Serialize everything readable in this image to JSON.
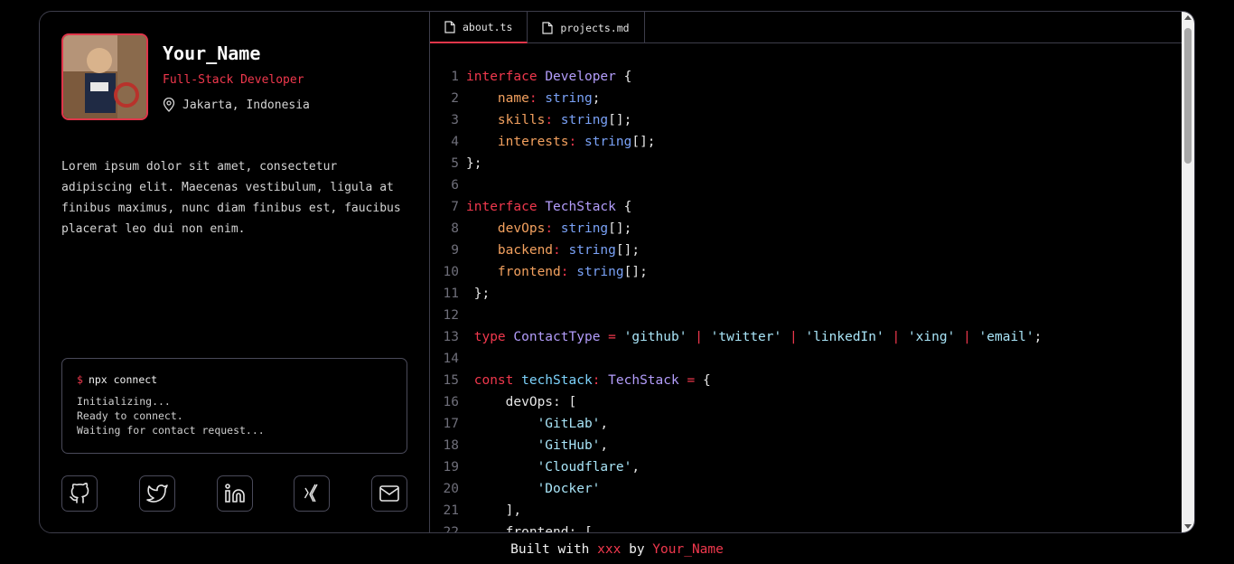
{
  "profile": {
    "name": "Your_Name",
    "role": "Full-Stack Developer",
    "location": "Jakarta, Indonesia",
    "bio": "Lorem ipsum dolor sit amet, consectetur adipiscing elit. Maecenas vestibulum, ligula at finibus maximus, nunc diam finibus est, faucibus placerat leo dui non enim."
  },
  "terminal": {
    "prompt": "$",
    "command": "npx connect",
    "lines": [
      "Initializing...",
      "Ready to connect.",
      "Waiting for contact request..."
    ]
  },
  "socials": [
    "github-icon",
    "twitter-icon",
    "linkedin-icon",
    "xing-icon",
    "email-icon"
  ],
  "tabs": [
    {
      "label": "about.ts",
      "active": true
    },
    {
      "label": "projects.md",
      "active": false
    }
  ],
  "code": [
    {
      "n": "1",
      "t": [
        [
          "k",
          "interface "
        ],
        [
          "t",
          "Developer"
        ],
        [
          "w",
          " {"
        ]
      ]
    },
    {
      "n": "2",
      "t": [
        [
          "w",
          "    "
        ],
        [
          "p",
          "name"
        ],
        [
          "k",
          ":"
        ],
        [
          "ty",
          " string"
        ],
        [
          "w",
          ";"
        ]
      ]
    },
    {
      "n": "3",
      "t": [
        [
          "w",
          "    "
        ],
        [
          "p",
          "skills"
        ],
        [
          "k",
          ":"
        ],
        [
          "ty",
          " string"
        ],
        [
          "w",
          "[];"
        ]
      ]
    },
    {
      "n": "4",
      "t": [
        [
          "w",
          "    "
        ],
        [
          "p",
          "interests"
        ],
        [
          "k",
          ":"
        ],
        [
          "ty",
          " string"
        ],
        [
          "w",
          "[];"
        ]
      ]
    },
    {
      "n": "5",
      "t": [
        [
          "w",
          "};"
        ]
      ]
    },
    {
      "n": "6",
      "t": []
    },
    {
      "n": "7",
      "t": [
        [
          "k",
          "interface "
        ],
        [
          "t",
          "TechStack"
        ],
        [
          "w",
          " {"
        ]
      ]
    },
    {
      "n": "8",
      "t": [
        [
          "w",
          "    "
        ],
        [
          "p",
          "devOps"
        ],
        [
          "k",
          ":"
        ],
        [
          "ty",
          " string"
        ],
        [
          "w",
          "[];"
        ]
      ]
    },
    {
      "n": "9",
      "t": [
        [
          "w",
          "    "
        ],
        [
          "p",
          "backend"
        ],
        [
          "k",
          ":"
        ],
        [
          "ty",
          " string"
        ],
        [
          "w",
          "[];"
        ]
      ]
    },
    {
      "n": "10",
      "t": [
        [
          "w",
          "    "
        ],
        [
          "p",
          "frontend"
        ],
        [
          "k",
          ":"
        ],
        [
          "ty",
          " string"
        ],
        [
          "w",
          "[];"
        ]
      ]
    },
    {
      "n": "11",
      "t": [
        [
          "w",
          " };"
        ]
      ]
    },
    {
      "n": "12",
      "t": []
    },
    {
      "n": "13",
      "t": [
        [
          "k",
          " type "
        ],
        [
          "t",
          "ContactType "
        ],
        [
          "k",
          "= "
        ],
        [
          "str",
          "'github' "
        ],
        [
          "k",
          "| "
        ],
        [
          "str",
          "'twitter' "
        ],
        [
          "k",
          "| "
        ],
        [
          "str",
          "'linkedIn' "
        ],
        [
          "k",
          "| "
        ],
        [
          "str",
          "'xing' "
        ],
        [
          "k",
          "| "
        ],
        [
          "str",
          "'email'"
        ],
        [
          "w",
          ";"
        ]
      ]
    },
    {
      "n": "14",
      "t": []
    },
    {
      "n": "15",
      "t": [
        [
          "k",
          " const "
        ],
        [
          "v",
          "techStack"
        ],
        [
          "k",
          ": "
        ],
        [
          "t",
          "TechStack "
        ],
        [
          "k",
          "= "
        ],
        [
          "w",
          "{"
        ]
      ]
    },
    {
      "n": "16",
      "t": [
        [
          "w",
          "     devOps: ["
        ]
      ]
    },
    {
      "n": "17",
      "t": [
        [
          "w",
          "         "
        ],
        [
          "str",
          "'GitLab'"
        ],
        [
          "w",
          ","
        ]
      ]
    },
    {
      "n": "18",
      "t": [
        [
          "w",
          "         "
        ],
        [
          "str",
          "'GitHub'"
        ],
        [
          "w",
          ","
        ]
      ]
    },
    {
      "n": "19",
      "t": [
        [
          "w",
          "         "
        ],
        [
          "str",
          "'Cloudflare'"
        ],
        [
          "w",
          ","
        ]
      ]
    },
    {
      "n": "20",
      "t": [
        [
          "w",
          "         "
        ],
        [
          "str",
          "'Docker'"
        ]
      ]
    },
    {
      "n": "21",
      "t": [
        [
          "w",
          "     ],"
        ]
      ]
    },
    {
      "n": "22",
      "t": [
        [
          "w",
          "     frontend: ["
        ]
      ]
    }
  ],
  "footer": {
    "built": "Built with",
    "tech": "xxx",
    "by": "by",
    "author": "Your_Name"
  }
}
